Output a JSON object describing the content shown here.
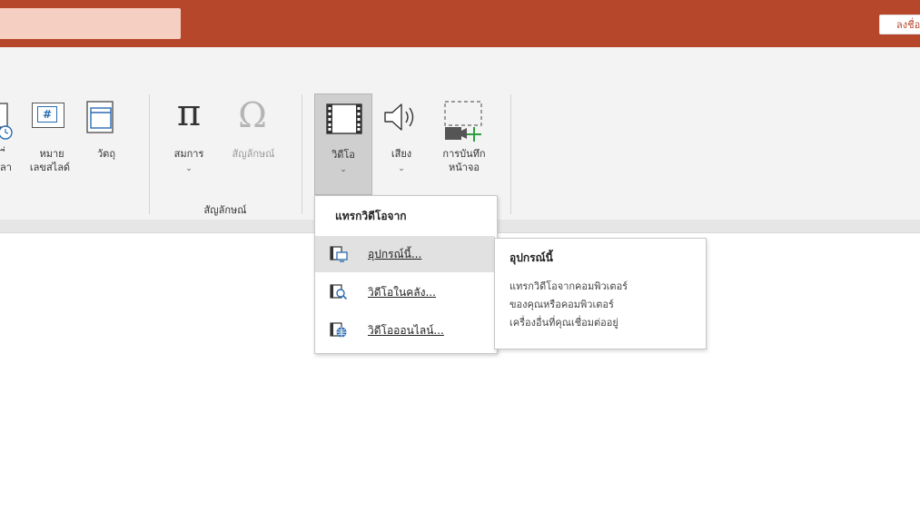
{
  "titlebar": {
    "signin_label": "ลงชื่อ",
    "accent_color": "#b7472a",
    "search_color": "#f6cfc3"
  },
  "ribbon": {
    "datetime_label_1": "ี่",
    "datetime_label_2": "ลา",
    "slide_number_label_1": "หมาย",
    "slide_number_label_2": "เลขสไลด์",
    "object_label": "วัตถุ",
    "slide_number_icon_text": "#",
    "symbols_group": {
      "equation_label": "สมการ",
      "symbol_label": "สัญลักษณ์",
      "group_label": "สัญลักษณ์"
    },
    "media_group": {
      "video_label": "วิดีโอ",
      "audio_label": "เสียง",
      "screen_recording_label_1": "การบันทึก",
      "screen_recording_label_2": "หน้าจอ"
    },
    "chevron": "⌄"
  },
  "video_menu": {
    "header": "แทรกวิดีโอจาก",
    "items": [
      {
        "label": "อุปกรณ์นี้...",
        "icon": "monitor-video-icon"
      },
      {
        "label": "วิดีโอในคลัง...",
        "icon": "search-video-icon"
      },
      {
        "label": "วิดีโอออนไลน์...",
        "icon": "globe-video-icon"
      }
    ]
  },
  "tooltip": {
    "title": "อุปกรณ์นี้",
    "lines": [
      "แทรกวิดีโอจากคอมพิวเตอร์",
      "ของคุณหรือคอมพิวเตอร์",
      "เครื่องอื่นที่คุณเชื่อมต่ออยู่"
    ]
  }
}
